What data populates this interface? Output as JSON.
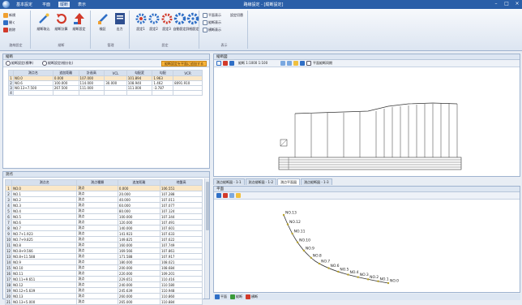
{
  "titlebar": {
    "menus": [
      "基本設定",
      "平面",
      "縦断",
      "表示"
    ],
    "active_menu": 2,
    "title": "路線設定 - [縦断設定]"
  },
  "ribbon": {
    "group1": {
      "buttons": [
        "新規",
        "開く",
        "削除"
      ],
      "label": "路線設定"
    },
    "group2": {
      "buttons": [
        "縦断取込",
        "縦断計算",
        "縦断設定"
      ],
      "label": "縦断"
    },
    "group3": {
      "buttons": [
        "検証",
        "出力"
      ],
      "label": "管理"
    },
    "group4": {
      "buttons": [
        "設定1",
        "設定2",
        "設定3",
        "自動設定",
        "詳細設定"
      ],
      "label": "設定"
    },
    "group5": {
      "checks": [
        "平面表示",
        "縦断表示",
        "横断表示"
      ],
      "extra": "設定切替",
      "label": "表示"
    }
  },
  "upper_panel": {
    "title": "縦断",
    "radio1": "縦断設定(標準)",
    "radio2": "縦断設定(細分化)",
    "action": "縦断設定を平面に追加する",
    "columns": [
      "測点名",
      "追加距離",
      "計画高",
      "VCL",
      "勾配変",
      "勾配",
      "VCR"
    ],
    "rows": [
      [
        "NO.0",
        "0.000",
        "107.000",
        "",
        "101.894",
        "1.963",
        ""
      ],
      [
        "NO.6",
        "100.000",
        "114.000",
        "30.000",
        "108.940",
        "1.462",
        "8091.910"
      ],
      [
        "NO.13+7.500",
        "267.500",
        "111.000",
        "",
        "111.000",
        "-3.787",
        ""
      ]
    ]
  },
  "lower_panel": {
    "title": "測点",
    "columns": [
      "測点名",
      "測点種類",
      "追加距離",
      "地盤高"
    ],
    "rows": [
      [
        "NO.0",
        "測点",
        "0.000",
        "106.551"
      ],
      [
        "NO.1",
        "測点",
        "20.000",
        "107.288"
      ],
      [
        "NO.2",
        "測点",
        "40.000",
        "107.011"
      ],
      [
        "NO.3",
        "測点",
        "60.000",
        "107.077"
      ],
      [
        "NO.4",
        "測点",
        "80.000",
        "107.124"
      ],
      [
        "NO.5",
        "測点",
        "100.000",
        "107.344"
      ],
      [
        "NO.6",
        "測点",
        "120.000",
        "107.491"
      ],
      [
        "NO.7",
        "測点",
        "140.000",
        "107.601"
      ],
      [
        "NO.7+1.923",
        "測点",
        "141.923",
        "107.633"
      ],
      [
        "NO.7+9.825",
        "測点",
        "149.825",
        "107.622"
      ],
      [
        "NO.8",
        "測点",
        "160.000",
        "107.749"
      ],
      [
        "NO.8+9.566",
        "測点",
        "169.566",
        "107.861"
      ],
      [
        "NO.8+11.588",
        "測点",
        "171.588",
        "107.917"
      ],
      [
        "NO.9",
        "測点",
        "180.000",
        "108.021"
      ],
      [
        "NO.10",
        "測点",
        "200.000",
        "108.684"
      ],
      [
        "NO.11",
        "測点",
        "220.000",
        "109.201"
      ],
      [
        "NO.11+9.651",
        "測点",
        "229.651",
        "110.416"
      ],
      [
        "NO.12",
        "測点",
        "240.000",
        "110.580"
      ],
      [
        "NO.12+5.639",
        "測点",
        "245.639",
        "110.948"
      ],
      [
        "NO.13",
        "測点",
        "260.000",
        "110.860"
      ],
      [
        "NO.13+5.000",
        "測点",
        "265.000",
        "110.884"
      ]
    ]
  },
  "profile_view": {
    "title": "縦断図",
    "scale": "縦断 1:1000 1:100",
    "toggle": "平面縦断同期"
  },
  "tabs": [
    "測点縦断図 - 1-1",
    "測点縦断図 - 1-2",
    "測点平面図",
    "測点縦断図 - 1-3"
  ],
  "active_tab": 2,
  "plan_view": {
    "title": "平面",
    "labels": [
      "NO.13",
      "NO.12",
      "NO.11",
      "NO.10",
      "NO.9",
      "NO.8",
      "NO.7",
      "NO.6",
      "NO.5",
      "NO.4",
      "NO.3",
      "NO.2",
      "NO.1",
      "NO.0"
    ]
  },
  "statusbar": [
    "平面",
    "縦断",
    "横断"
  ],
  "colors": {
    "accent": "#2a5fa8",
    "ribbon_blue": "#2f6fc6",
    "ribbon_red": "#d23a2a",
    "alignment": "#333333",
    "points": "#b8a22a"
  }
}
